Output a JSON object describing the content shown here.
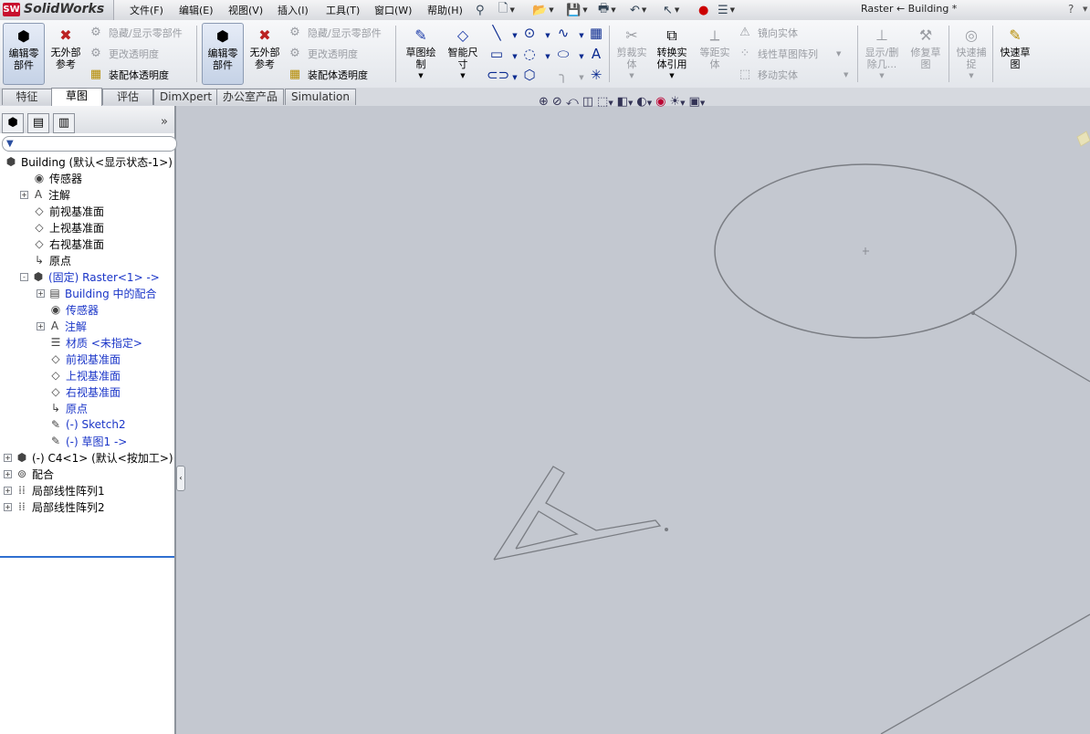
{
  "app": {
    "logo_badge": "SW",
    "logo_text": "SolidWorks",
    "title": "Raster ← Building *",
    "help": "?"
  },
  "menu": [
    "文件(F)",
    "编辑(E)",
    "视图(V)",
    "插入(I)",
    "工具(T)",
    "窗口(W)",
    "帮助(H)"
  ],
  "toolbar": {
    "edit_part_1": "编辑零\n部件",
    "no_external_ref_1": "无外部\n参考",
    "hide_show_components_1": "隐藏/显示零部件",
    "change_transparency_1": "更改透明度",
    "assembly_transparency_1": "装配体透明度",
    "edit_part_2": "编辑零\n部件",
    "no_external_ref_2": "无外部\n参考",
    "hide_show_components_2": "隐藏/显示零部件",
    "change_transparency_2": "更改透明度",
    "assembly_transparency_2": "装配体透明度",
    "sketch": "草图绘\n制",
    "smart_dimension": "智能尺\n寸",
    "trim_entities": "剪裁实\n体",
    "convert_entities": "转换实\n体引用",
    "offset_entities": "等距实\n体",
    "mirror_entities": "镜向实体",
    "linear_sketch_pattern": "线性草图阵列",
    "move_entities": "移动实体",
    "display_delete_relations": "显示/删\n除几...",
    "repair_sketch": "修复草\n图",
    "quick_snaps": "快速捕\n捉",
    "rapid_sketch": "快速草\n图"
  },
  "tabs": [
    "特征",
    "草图",
    "评估",
    "DimXpert",
    "办公室产品",
    "Simulation"
  ],
  "active_tab": "草图",
  "tree": [
    {
      "label": "Building  (默认<显示状态-1>)",
      "icon": "assembly-icon",
      "indent": 0,
      "expander": "",
      "blue": false
    },
    {
      "label": "传感器",
      "icon": "sensor-icon",
      "indent": 1,
      "expander": "",
      "blue": false
    },
    {
      "label": "注解",
      "icon": "annotation-icon",
      "indent": 1,
      "expander": "+",
      "blue": false
    },
    {
      "label": "前视基准面",
      "icon": "plane-icon",
      "indent": 1,
      "expander": "",
      "blue": false
    },
    {
      "label": "上视基准面",
      "icon": "plane-icon",
      "indent": 1,
      "expander": "",
      "blue": false
    },
    {
      "label": "右视基准面",
      "icon": "plane-icon",
      "indent": 1,
      "expander": "",
      "blue": false
    },
    {
      "label": "原点",
      "icon": "origin-icon",
      "indent": 1,
      "expander": "",
      "blue": false
    },
    {
      "label": "(固定) Raster<1> ->",
      "icon": "part-icon",
      "indent": 1,
      "expander": "-",
      "blue": true
    },
    {
      "label": "Building 中的配合",
      "icon": "mates-folder-icon",
      "indent": 2,
      "expander": "+",
      "blue": true
    },
    {
      "label": "传感器",
      "icon": "sensor-icon",
      "indent": 2,
      "expander": "",
      "blue": true
    },
    {
      "label": "注解",
      "icon": "annotation-icon",
      "indent": 2,
      "expander": "+",
      "blue": true
    },
    {
      "label": "材质 <未指定>",
      "icon": "material-icon",
      "indent": 2,
      "expander": "",
      "blue": true
    },
    {
      "label": "前视基准面",
      "icon": "plane-icon",
      "indent": 2,
      "expander": "",
      "blue": true
    },
    {
      "label": "上视基准面",
      "icon": "plane-icon",
      "indent": 2,
      "expander": "",
      "blue": true
    },
    {
      "label": "右视基准面",
      "icon": "plane-icon",
      "indent": 2,
      "expander": "",
      "blue": true
    },
    {
      "label": "原点",
      "icon": "origin-icon",
      "indent": 2,
      "expander": "",
      "blue": true
    },
    {
      "label": "(-) Sketch2",
      "icon": "sketch-icon",
      "indent": 2,
      "expander": "",
      "blue": true
    },
    {
      "label": "(-) 草图1 ->",
      "icon": "sketch-icon",
      "indent": 2,
      "expander": "",
      "blue": true
    },
    {
      "label": "(-) C4<1> (默认<按加工>)",
      "icon": "part-icon",
      "indent": 0,
      "expander": "+",
      "blue": false
    },
    {
      "label": "配合",
      "icon": "mates-icon",
      "indent": 0,
      "expander": "+",
      "blue": false
    },
    {
      "label": "局部线性阵列1",
      "icon": "pattern-icon",
      "indent": 0,
      "expander": "+",
      "blue": false
    },
    {
      "label": "局部线性阵列2",
      "icon": "pattern-icon",
      "indent": 0,
      "expander": "+",
      "blue": false
    }
  ]
}
